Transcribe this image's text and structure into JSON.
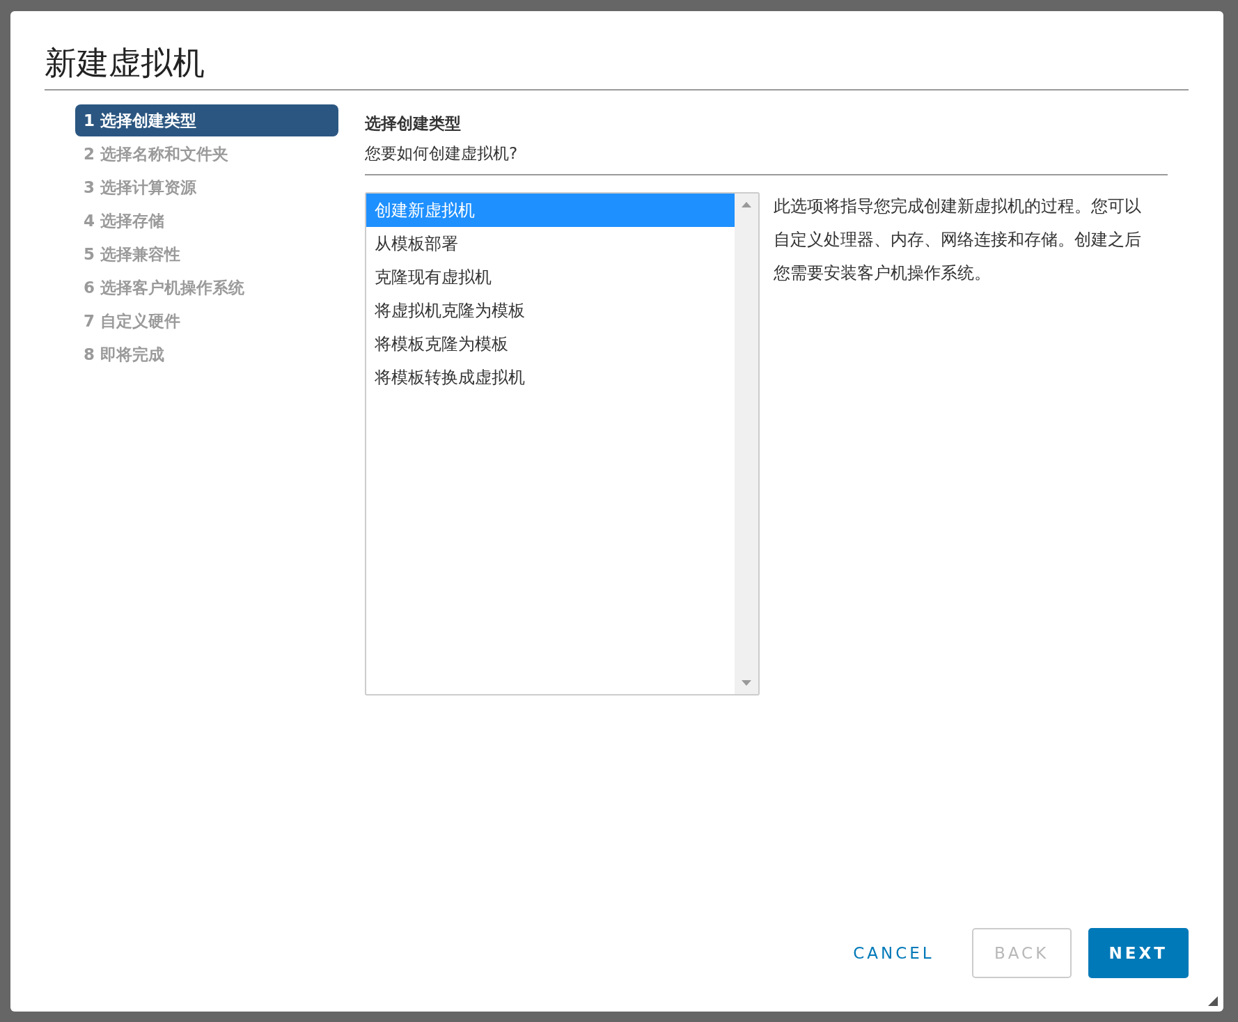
{
  "dialog": {
    "title": "新建虚拟机"
  },
  "steps": [
    {
      "label": "1 选择创建类型",
      "selected": true
    },
    {
      "label": "2 选择名称和文件夹",
      "selected": false
    },
    {
      "label": "3 选择计算资源",
      "selected": false
    },
    {
      "label": "4 选择存储",
      "selected": false
    },
    {
      "label": "5 选择兼容性",
      "selected": false
    },
    {
      "label": "6 选择客户机操作系统",
      "selected": false
    },
    {
      "label": "7 自定义硬件",
      "selected": false
    },
    {
      "label": "8 即将完成",
      "selected": false
    }
  ],
  "content": {
    "heading": "选择创建类型",
    "subtitle": "您要如何创建虚拟机?",
    "options": [
      {
        "label": "创建新虚拟机",
        "selected": true
      },
      {
        "label": "从模板部署",
        "selected": false
      },
      {
        "label": "克隆现有虚拟机",
        "selected": false
      },
      {
        "label": "将虚拟机克隆为模板",
        "selected": false
      },
      {
        "label": "将模板克隆为模板",
        "selected": false
      },
      {
        "label": "将模板转换成虚拟机",
        "selected": false
      }
    ],
    "description": "此选项将指导您完成创建新虚拟机的过程。您可以自定义处理器、内存、网络连接和存储。创建之后您需要安装客户机操作系统。"
  },
  "buttons": [
    {
      "label": "CANCEL",
      "kind": "flat",
      "disabled": false
    },
    {
      "label": "BACK",
      "kind": "outline",
      "disabled": true
    },
    {
      "label": "NEXT",
      "kind": "primary",
      "disabled": false
    }
  ]
}
